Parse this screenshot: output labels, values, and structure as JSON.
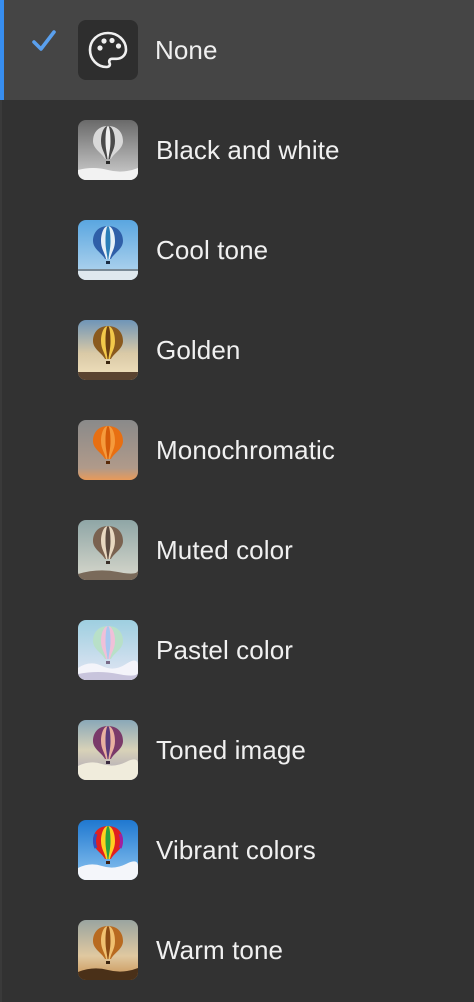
{
  "menu": {
    "items": [
      {
        "label": "None",
        "selected": true,
        "icon": "palette-icon"
      },
      {
        "label": "Black and white",
        "selected": false,
        "icon": "balloon-bw-thumbnail"
      },
      {
        "label": "Cool tone",
        "selected": false,
        "icon": "balloon-cool-thumbnail"
      },
      {
        "label": "Golden",
        "selected": false,
        "icon": "balloon-golden-thumbnail"
      },
      {
        "label": "Monochromatic",
        "selected": false,
        "icon": "balloon-monochromatic-thumbnail"
      },
      {
        "label": "Muted color",
        "selected": false,
        "icon": "balloon-muted-thumbnail"
      },
      {
        "label": "Pastel color",
        "selected": false,
        "icon": "balloon-pastel-thumbnail"
      },
      {
        "label": "Toned image",
        "selected": false,
        "icon": "balloon-toned-thumbnail"
      },
      {
        "label": "Vibrant colors",
        "selected": false,
        "icon": "balloon-vibrant-thumbnail"
      },
      {
        "label": "Warm tone",
        "selected": false,
        "icon": "balloon-warm-thumbnail"
      }
    ]
  },
  "colors": {
    "background": "#323232",
    "selected_background": "#454545",
    "accent": "#378ef0",
    "text": "#f0f0f0"
  }
}
